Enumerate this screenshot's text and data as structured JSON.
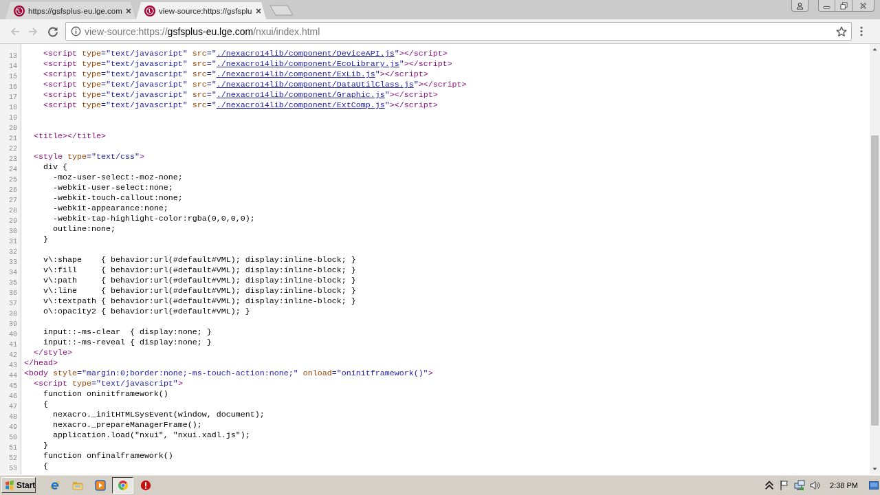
{
  "tabs": [
    {
      "title": "https://gsfsplus-eu.lge.com",
      "selected": false
    },
    {
      "title": "view-source:https://gsfsplu",
      "selected": true
    }
  ],
  "toolbar": {
    "back": {
      "disabled": true
    },
    "forward": {
      "disabled": true
    },
    "address": {
      "scheme": "view-source:https://",
      "host": "gsfsplus-eu.lge.com",
      "path": "/nxui/index.html"
    }
  },
  "source_lines": [
    {
      "number": "13",
      "tokens": [
        {
          "kind": "tag",
          "text": "    <script"
        },
        {
          "kind": "attr",
          "text": " type"
        },
        {
          "kind": "value",
          "text": "=\"text/javascript\""
        },
        {
          "kind": "attr",
          "text": " src"
        },
        {
          "kind": "value",
          "text": "=\""
        },
        {
          "kind": "link",
          "text": "./nexacro14lib/component/DeviceAPI.js"
        },
        {
          "kind": "value",
          "text": "\""
        },
        {
          "kind": "tag",
          "text": "></script>"
        }
      ]
    },
    {
      "number": "14",
      "tokens": [
        {
          "kind": "tag",
          "text": "    <script"
        },
        {
          "kind": "attr",
          "text": " type"
        },
        {
          "kind": "value",
          "text": "=\"text/javascript\""
        },
        {
          "kind": "attr",
          "text": " src"
        },
        {
          "kind": "value",
          "text": "=\""
        },
        {
          "kind": "link",
          "text": "./nexacro14lib/component/EcoLibrary.js"
        },
        {
          "kind": "value",
          "text": "\""
        },
        {
          "kind": "tag",
          "text": "></script>"
        }
      ]
    },
    {
      "number": "15",
      "tokens": [
        {
          "kind": "tag",
          "text": "    <script"
        },
        {
          "kind": "attr",
          "text": " type"
        },
        {
          "kind": "value",
          "text": "=\"text/javascript\""
        },
        {
          "kind": "attr",
          "text": " src"
        },
        {
          "kind": "value",
          "text": "=\""
        },
        {
          "kind": "link",
          "text": "./nexacro14lib/component/ExLib.js"
        },
        {
          "kind": "value",
          "text": "\""
        },
        {
          "kind": "tag",
          "text": "></script>"
        }
      ]
    },
    {
      "number": "16",
      "tokens": [
        {
          "kind": "tag",
          "text": "    <script"
        },
        {
          "kind": "attr",
          "text": " type"
        },
        {
          "kind": "value",
          "text": "=\"text/javascript\""
        },
        {
          "kind": "attr",
          "text": " src"
        },
        {
          "kind": "value",
          "text": "=\""
        },
        {
          "kind": "link",
          "text": "./nexacro14lib/component/DataUtilClass.js"
        },
        {
          "kind": "value",
          "text": "\""
        },
        {
          "kind": "tag",
          "text": "></script>"
        }
      ]
    },
    {
      "number": "17",
      "tokens": [
        {
          "kind": "tag",
          "text": "    <script"
        },
        {
          "kind": "attr",
          "text": " type"
        },
        {
          "kind": "value",
          "text": "=\"text/javascript\""
        },
        {
          "kind": "attr",
          "text": " src"
        },
        {
          "kind": "value",
          "text": "=\""
        },
        {
          "kind": "link",
          "text": "./nexacro14lib/component/Graphic.js"
        },
        {
          "kind": "value",
          "text": "\""
        },
        {
          "kind": "tag",
          "text": "></script>"
        }
      ]
    },
    {
      "number": "18",
      "tokens": [
        {
          "kind": "tag",
          "text": "    <script"
        },
        {
          "kind": "attr",
          "text": " type"
        },
        {
          "kind": "value",
          "text": "=\"text/javascript\""
        },
        {
          "kind": "attr",
          "text": " src"
        },
        {
          "kind": "value",
          "text": "=\""
        },
        {
          "kind": "link",
          "text": "./nexacro14lib/component/ExtComp.js"
        },
        {
          "kind": "value",
          "text": "\""
        },
        {
          "kind": "tag",
          "text": "></script>"
        }
      ]
    },
    {
      "number": "19"
    },
    {
      "number": "20"
    },
    {
      "number": "21",
      "tokens": [
        {
          "kind": "tag",
          "text": "  <title></title>"
        }
      ]
    },
    {
      "number": "22"
    },
    {
      "number": "23",
      "tokens": [
        {
          "kind": "tag",
          "text": "  <style"
        },
        {
          "kind": "attr",
          "text": " type"
        },
        {
          "kind": "value",
          "text": "=\"text/css\""
        },
        {
          "kind": "tag",
          "text": ">"
        }
      ]
    },
    {
      "number": "24",
      "tokens": [
        {
          "kind": "text",
          "text": "    div {"
        }
      ]
    },
    {
      "number": "25",
      "tokens": [
        {
          "kind": "text",
          "text": "      -moz-user-select:-moz-none;"
        }
      ]
    },
    {
      "number": "26",
      "tokens": [
        {
          "kind": "text",
          "text": "      -webkit-user-select:none;"
        }
      ]
    },
    {
      "number": "27",
      "tokens": [
        {
          "kind": "text",
          "text": "      -webkit-touch-callout:none;"
        }
      ]
    },
    {
      "number": "28",
      "tokens": [
        {
          "kind": "text",
          "text": "      -webkit-appearance:none;"
        }
      ]
    },
    {
      "number": "29",
      "tokens": [
        {
          "kind": "text",
          "text": "      -webkit-tap-highlight-color:rgba(0,0,0,0);"
        }
      ]
    },
    {
      "number": "30",
      "tokens": [
        {
          "kind": "text",
          "text": "      outline:none;"
        }
      ]
    },
    {
      "number": "31",
      "tokens": [
        {
          "kind": "text",
          "text": "    }"
        }
      ]
    },
    {
      "number": "32"
    },
    {
      "number": "33",
      "tokens": [
        {
          "kind": "text",
          "text": "    v\\:shape    { behavior:url(#default#VML); display:inline-block; }"
        }
      ]
    },
    {
      "number": "34",
      "tokens": [
        {
          "kind": "text",
          "text": "    v\\:fill     { behavior:url(#default#VML); display:inline-block; }"
        }
      ]
    },
    {
      "number": "35",
      "tokens": [
        {
          "kind": "text",
          "text": "    v\\:path     { behavior:url(#default#VML); display:inline-block; }"
        }
      ]
    },
    {
      "number": "36",
      "tokens": [
        {
          "kind": "text",
          "text": "    v\\:line     { behavior:url(#default#VML); display:inline-block; }"
        }
      ]
    },
    {
      "number": "37",
      "tokens": [
        {
          "kind": "text",
          "text": "    v\\:textpath { behavior:url(#default#VML); display:inline-block; }"
        }
      ]
    },
    {
      "number": "38",
      "tokens": [
        {
          "kind": "text",
          "text": "    o\\:opacity2 { behavior:url(#default#VML); }"
        }
      ]
    },
    {
      "number": "39"
    },
    {
      "number": "40",
      "tokens": [
        {
          "kind": "text",
          "text": "    input::-ms-clear  { display:none; }"
        }
      ]
    },
    {
      "number": "41",
      "tokens": [
        {
          "kind": "text",
          "text": "    input::-ms-reveal { display:none; }"
        }
      ]
    },
    {
      "number": "42",
      "tokens": [
        {
          "kind": "tag",
          "text": "  </style>"
        }
      ]
    },
    {
      "number": "43",
      "tokens": [
        {
          "kind": "tag",
          "text": "</head>"
        }
      ]
    },
    {
      "number": "44",
      "tokens": [
        {
          "kind": "tag",
          "text": "<body"
        },
        {
          "kind": "attr",
          "text": " style"
        },
        {
          "kind": "value",
          "text": "=\"margin:0;border:none;-ms-touch-action:none;\""
        },
        {
          "kind": "attr",
          "text": " onload"
        },
        {
          "kind": "value",
          "text": "=\"oninitframework()\""
        },
        {
          "kind": "tag",
          "text": ">"
        }
      ]
    },
    {
      "number": "45",
      "tokens": [
        {
          "kind": "tag",
          "text": "  <script"
        },
        {
          "kind": "attr",
          "text": " type"
        },
        {
          "kind": "value",
          "text": "=\"text/javascript\""
        },
        {
          "kind": "tag",
          "text": ">"
        }
      ]
    },
    {
      "number": "46",
      "tokens": [
        {
          "kind": "text",
          "text": "    function oninitframework()"
        }
      ]
    },
    {
      "number": "47",
      "tokens": [
        {
          "kind": "text",
          "text": "    {"
        }
      ]
    },
    {
      "number": "48",
      "tokens": [
        {
          "kind": "text",
          "text": "      nexacro._initHTMLSysEvent(window, document);"
        }
      ]
    },
    {
      "number": "49",
      "tokens": [
        {
          "kind": "text",
          "text": "      nexacro._prepareManagerFrame();"
        }
      ]
    },
    {
      "number": "50",
      "tokens": [
        {
          "kind": "text",
          "text": "      application.load(\"nxui\", \"nxui.xadl.js\");"
        }
      ]
    },
    {
      "number": "51",
      "tokens": [
        {
          "kind": "text",
          "text": "    }"
        }
      ]
    },
    {
      "number": "52",
      "tokens": [
        {
          "kind": "text",
          "text": "    function onfinalframework()"
        }
      ]
    },
    {
      "number": "53",
      "tokens": [
        {
          "kind": "text",
          "text": "    {"
        }
      ]
    }
  ],
  "taskbar": {
    "start_label": "Start",
    "apps": [
      {
        "kind": "ie",
        "selected": false
      },
      {
        "kind": "folder",
        "selected": false
      },
      {
        "kind": "media",
        "selected": false
      },
      {
        "kind": "chrome",
        "selected": true
      },
      {
        "kind": "stop",
        "selected": false
      }
    ],
    "clock": "2:38 PM"
  }
}
